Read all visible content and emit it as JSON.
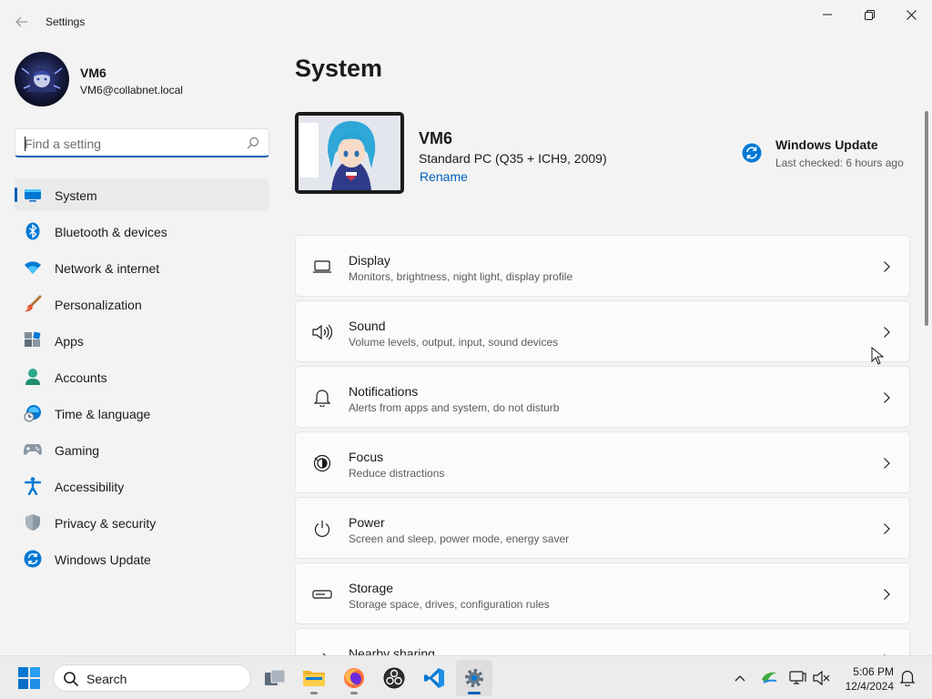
{
  "window": {
    "app_title": "Settings"
  },
  "profile": {
    "name": "VM6",
    "email": "VM6@collabnet.local"
  },
  "search": {
    "placeholder": "Find a setting"
  },
  "sidebar": {
    "items": [
      {
        "label": "System",
        "icon": "system-icon",
        "selected": true
      },
      {
        "label": "Bluetooth & devices",
        "icon": "bluetooth-icon"
      },
      {
        "label": "Network & internet",
        "icon": "wifi-icon"
      },
      {
        "label": "Personalization",
        "icon": "brush-icon"
      },
      {
        "label": "Apps",
        "icon": "apps-icon"
      },
      {
        "label": "Accounts",
        "icon": "accounts-icon"
      },
      {
        "label": "Time & language",
        "icon": "time-language-icon"
      },
      {
        "label": "Gaming",
        "icon": "gamepad-icon"
      },
      {
        "label": "Accessibility",
        "icon": "accessibility-icon"
      },
      {
        "label": "Privacy & security",
        "icon": "shield-icon"
      },
      {
        "label": "Windows Update",
        "icon": "windows-update-icon"
      }
    ]
  },
  "main": {
    "title": "System",
    "device": {
      "name": "VM6",
      "model": "Standard PC (Q35 + ICH9, 2009)",
      "rename_label": "Rename"
    },
    "windows_update": {
      "title": "Windows Update",
      "status": "Last checked: 6 hours ago"
    },
    "cards": [
      {
        "title": "Display",
        "desc": "Monitors, brightness, night light, display profile",
        "icon": "display-icon"
      },
      {
        "title": "Sound",
        "desc": "Volume levels, output, input, sound devices",
        "icon": "speaker-icon"
      },
      {
        "title": "Notifications",
        "desc": "Alerts from apps and system, do not disturb",
        "icon": "bell-icon"
      },
      {
        "title": "Focus",
        "desc": "Reduce distractions",
        "icon": "focus-icon"
      },
      {
        "title": "Power",
        "desc": "Screen and sleep, power mode, energy saver",
        "icon": "power-icon"
      },
      {
        "title": "Storage",
        "desc": "Storage space, drives, configuration rules",
        "icon": "storage-icon"
      },
      {
        "title": "Nearby sharing",
        "desc": "",
        "icon": "share-icon"
      }
    ]
  },
  "taskbar": {
    "search_label": "Search",
    "apps": [
      "task-view-icon",
      "file-explorer-icon",
      "firefox-icon",
      "obs-icon",
      "vscode-icon",
      "settings-icon"
    ],
    "time": "5:06 PM",
    "date": "12/4/2024"
  },
  "colors": {
    "accent": "#005fb8",
    "background": "#f3f3f3",
    "card": "#fbfbfb"
  }
}
